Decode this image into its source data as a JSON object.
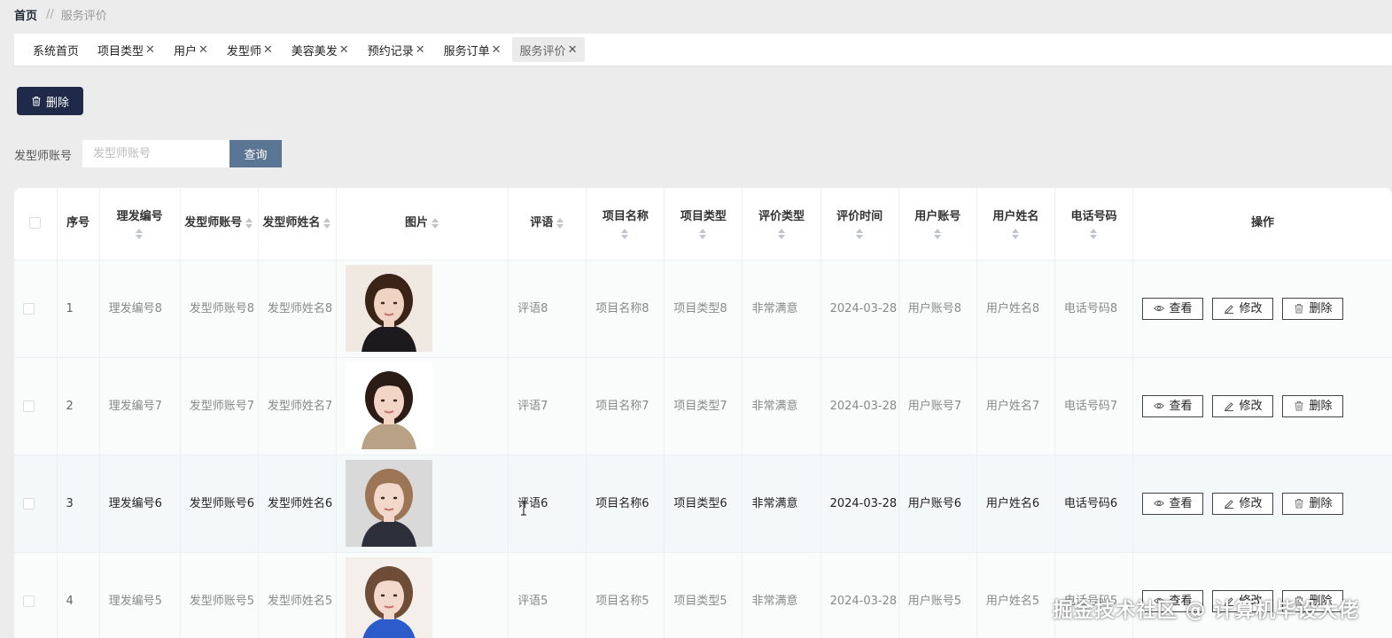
{
  "breadcrumb": {
    "home": "首页",
    "separator": "//",
    "current": "服务评价"
  },
  "tabs": [
    {
      "label": "系统首页",
      "closable": false,
      "active": false
    },
    {
      "label": "项目类型",
      "closable": true,
      "active": false
    },
    {
      "label": "用户",
      "closable": true,
      "active": false
    },
    {
      "label": "发型师",
      "closable": true,
      "active": false
    },
    {
      "label": "美容美发",
      "closable": true,
      "active": false
    },
    {
      "label": "预约记录",
      "closable": true,
      "active": false
    },
    {
      "label": "服务订单",
      "closable": true,
      "active": false
    },
    {
      "label": "服务评价",
      "closable": true,
      "active": true
    }
  ],
  "toolbar": {
    "delete_label": "删除",
    "delete_icon": "trash-icon",
    "delete_color": "#1e2a47"
  },
  "search": {
    "label": "发型师账号",
    "placeholder": "发型师账号",
    "value": "",
    "button_label": "查询",
    "button_color": "#5b7594"
  },
  "table": {
    "columns": [
      "序号",
      "理发编号",
      "发型师账号",
      "发型师姓名",
      "图片",
      "评语",
      "项目名称",
      "项目类型",
      "评价类型",
      "评价时间",
      "用户账号",
      "用户姓名",
      "电话号码",
      "操作"
    ],
    "actions": {
      "view": "查看",
      "edit": "修改",
      "delete": "删除"
    },
    "rows": [
      {
        "index": "1",
        "code": "理发编号8",
        "stylist_account": "发型师账号8",
        "stylist_name": "发型师姓名8",
        "comment": "评语8",
        "project_name": "项目名称8",
        "project_type": "项目类型8",
        "rating_type": "非常满意",
        "rating_time": "2024-03-28",
        "user_account": "用户账号8",
        "user_name": "用户姓名8",
        "phone": "电话号码8"
      },
      {
        "index": "2",
        "code": "理发编号7",
        "stylist_account": "发型师账号7",
        "stylist_name": "发型师姓名7",
        "comment": "评语7",
        "project_name": "项目名称7",
        "project_type": "项目类型7",
        "rating_type": "非常满意",
        "rating_time": "2024-03-28",
        "user_account": "用户账号7",
        "user_name": "用户姓名7",
        "phone": "电话号码7"
      },
      {
        "index": "3",
        "code": "理发编号6",
        "stylist_account": "发型师账号6",
        "stylist_name": "发型师姓名6",
        "comment": "评语6",
        "project_name": "项目名称6",
        "project_type": "项目类型6",
        "rating_type": "非常满意",
        "rating_time": "2024-03-28",
        "user_account": "用户账号6",
        "user_name": "用户姓名6",
        "phone": "电话号码6"
      },
      {
        "index": "4",
        "code": "理发编号5",
        "stylist_account": "发型师账号5",
        "stylist_name": "发型师姓名5",
        "comment": "评语5",
        "project_name": "项目名称5",
        "project_type": "项目类型5",
        "rating_type": "非常满意",
        "rating_time": "2024-03-28",
        "user_account": "用户账号5",
        "user_name": "用户姓名5",
        "phone": "电话号码5"
      }
    ]
  },
  "watermark": "掘金技术社区 @ 计算机毕设大佬"
}
